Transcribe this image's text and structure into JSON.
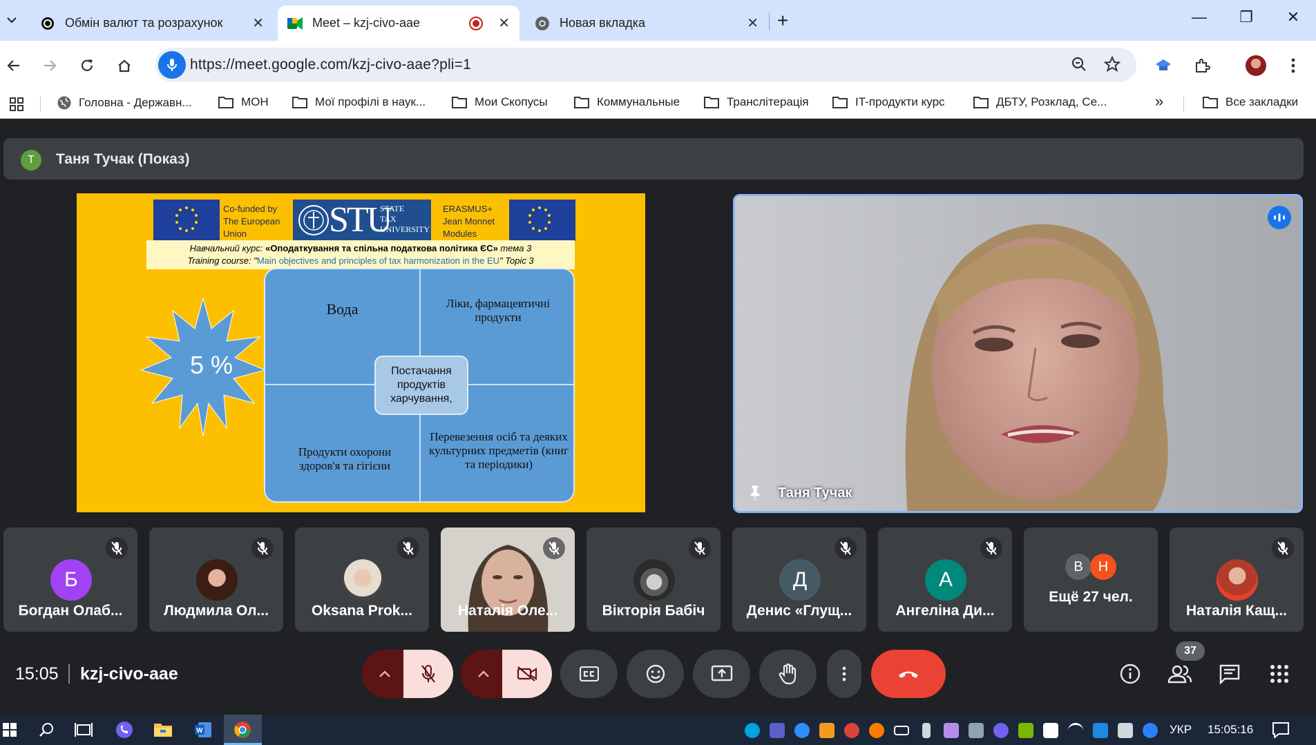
{
  "tabs": [
    {
      "title": "Обмін валют та розрахунок",
      "close": "✕"
    },
    {
      "title": "Meet – kzj-civo-aae",
      "close": "✕"
    },
    {
      "title": "Новая вкладка",
      "close": "✕"
    }
  ],
  "window": {
    "new_tab": "+",
    "minimize": "—",
    "restore": "❐",
    "close": "✕"
  },
  "omnibox": {
    "url": "https://meet.google.com/kzj-civo-aae?pli=1"
  },
  "bookmarks": [
    {
      "label": "Головна - Державн...",
      "icon": "globe-icon"
    },
    {
      "label": "МОН",
      "icon": "folder-icon"
    },
    {
      "label": "Мої профілі в наук...",
      "icon": "folder-icon"
    },
    {
      "label": "Мои Скопусы",
      "icon": "folder-icon"
    },
    {
      "label": "Коммунальные",
      "icon": "folder-icon"
    },
    {
      "label": "Транслітерація",
      "icon": "folder-icon"
    },
    {
      "label": "IT-продукти курс",
      "icon": "folder-icon"
    },
    {
      "label": "ДБТУ, Розклад, Се...",
      "icon": "folder-icon"
    }
  ],
  "bookmarks_overflow": "»",
  "all_bookmarks": "Все закладки",
  "presenter": {
    "initial": "Т",
    "name": "Таня Тучак (Показ)"
  },
  "slide": {
    "eu_left": "Co-funded by The European Union",
    "stu_top": "STATE",
    "stu_mid": "TAX",
    "stu_bot": "UNIVERSITY",
    "stu_mark": "STU",
    "erasmus": "ERASMUS+ Jean Monnet Modules",
    "course_ua_prefix": "Навчальний курс:",
    "course_ua_title": "«Оподаткування та спільна податкова політика ЄС»",
    "course_ua_topic": "тема 3",
    "course_en_prefix": "Training course: \"",
    "course_en_title": "Main objectives and principles of tax harmonization in the EU",
    "course_en_topic": "\" Topic 3",
    "rate": "5 %",
    "cell_tl": "Вода",
    "cell_tr": "Ліки, фармацевтичні продукти",
    "cell_bl": "Продукти охорони здоров'я та гігієни",
    "cell_br": "Перевезення осіб та деяких культурних предметів (книг та періодики)",
    "center": "Постачання продуктів харчування,"
  },
  "speaker": {
    "name": "Таня Тучак"
  },
  "participants": [
    {
      "name": "Богдан Олаб...",
      "initial": "Б",
      "color": "#a142f4"
    },
    {
      "name": "Людмила Ол...",
      "initial": "",
      "color": "#5a2a1e"
    },
    {
      "name": "Oksana Prok...",
      "initial": "",
      "color": "#d9c7b5"
    },
    {
      "name": "Наталія Оле...",
      "initial": "",
      "color": "#8b7765"
    },
    {
      "name": "Вікторія Бабіч",
      "initial": "",
      "color": "#777777"
    },
    {
      "name": "Денис «Глущ...",
      "initial": "Д",
      "color": "#455a64"
    },
    {
      "name": "Ангеліна Ди...",
      "initial": "А",
      "color": "#00897b"
    },
    {
      "name": "Ещё 27 чел.",
      "initial_1": "В",
      "initial_2": "Н",
      "color_1": "#5f6368",
      "color_2": "#f4511e"
    },
    {
      "name": "Наталія Кащ...",
      "initial": "",
      "color": "#c0392b"
    }
  ],
  "bottom": {
    "time": "15:05",
    "code": "kzj-civo-aae",
    "people_count": "37"
  },
  "taskbar": {
    "lang": "УКР",
    "clock": "15:05:16"
  },
  "colors": {
    "accent": "#1a73e8",
    "hangup": "#ea4335",
    "slide_bg": "#fcc000",
    "grid_blue": "#5b9bd5"
  }
}
